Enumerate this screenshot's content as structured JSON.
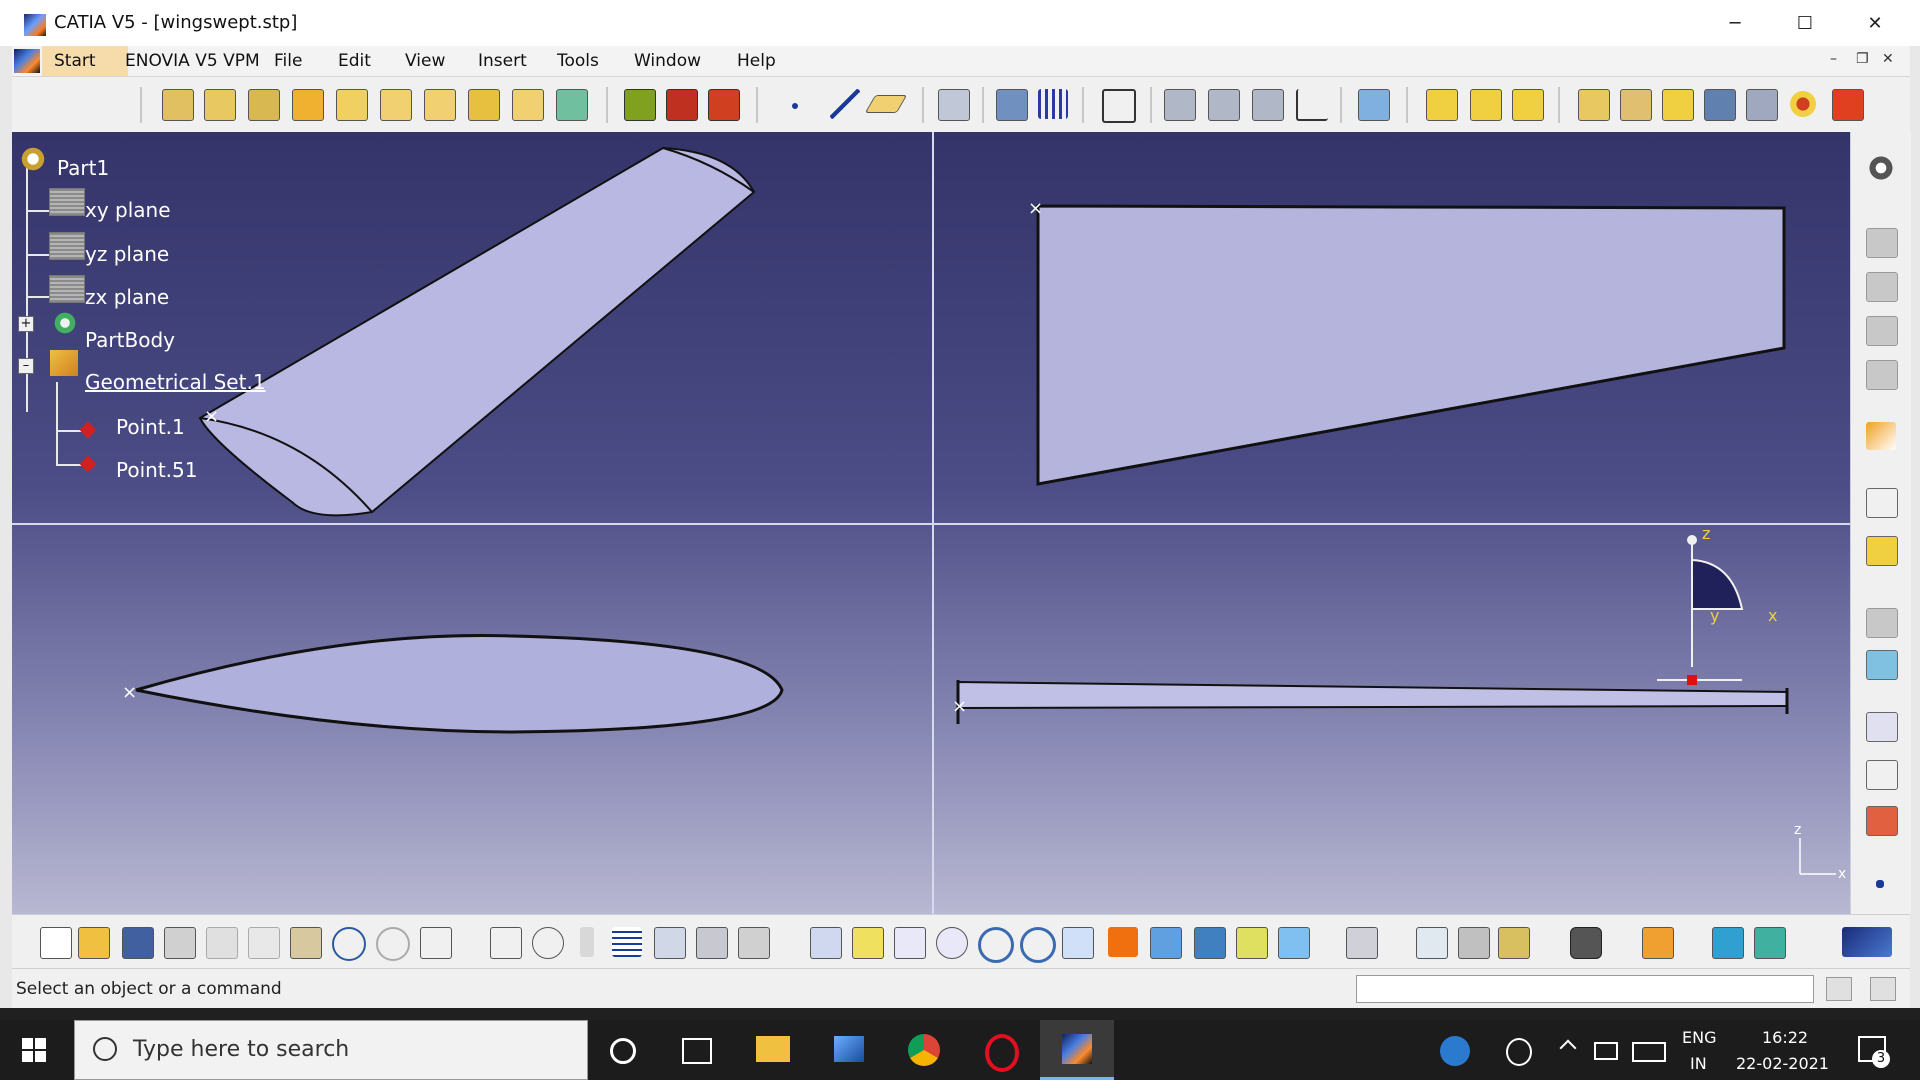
{
  "window": {
    "title": "CATIA V5 - [wingswept.stp]",
    "minimize": "─",
    "maximize": "☐",
    "close": "✕"
  },
  "menu": {
    "items": [
      "Start",
      "ENOVIA V5 VPM",
      "File",
      "Edit",
      "View",
      "Insert",
      "Tools",
      "Window",
      "Help"
    ],
    "mdi_minimize": "–",
    "mdi_restore": "❐",
    "mdi_close": "✕"
  },
  "tree": {
    "root": "Part1",
    "nodes": [
      "xy plane",
      "yz plane",
      "zx plane",
      "PartBody",
      "Geometrical Set.1",
      "Point.1",
      "Point.51"
    ],
    "expand_plus": "+",
    "collapse_minus": "–"
  },
  "compass": {
    "z": "z",
    "y": "y",
    "x": "x"
  },
  "axis_triad": {
    "z": "z",
    "x": "x"
  },
  "status": {
    "message": "Select an object or a command",
    "command_value": ""
  },
  "taskbar": {
    "search_placeholder": "Type here to search",
    "language_top": "ENG",
    "language_bottom": "IN",
    "time": "16:22",
    "date": "22-02-2021",
    "notification_count": "3"
  },
  "colors": {
    "viewport_top": "#34346a",
    "viewport_bottom": "#b8b8d2",
    "part_fill": "#b8b8e0",
    "selection_menu": "#f6dcaa"
  }
}
